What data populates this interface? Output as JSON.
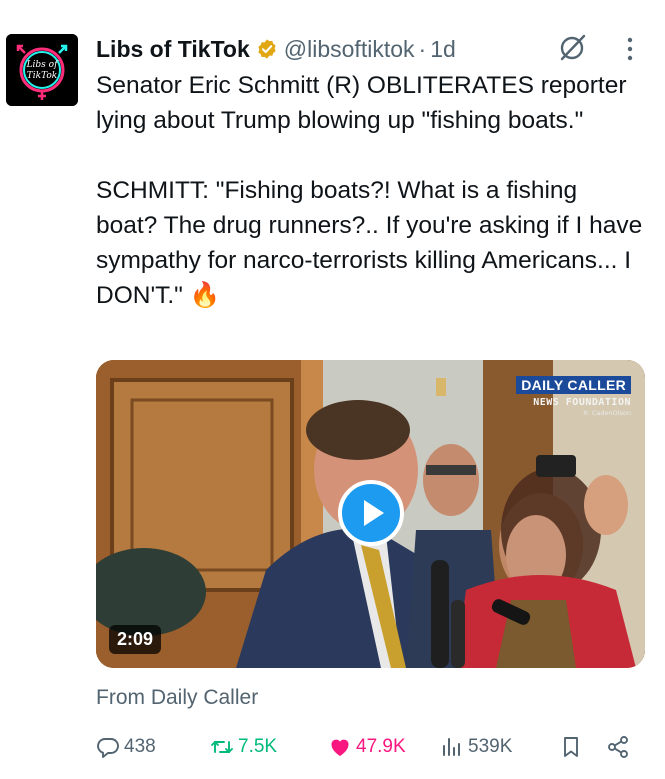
{
  "author": {
    "display_name": "Libs of TikTok",
    "handle": "@libsoftiktok",
    "separator": "·",
    "timestamp": "1d",
    "verified_badge": "verified-gold-icon",
    "avatar_text": "Libs of TikTok",
    "avatar_bg": "#000000"
  },
  "tweet": {
    "text": "Senator Eric Schmitt (R) OBLITERATES reporter lying about Trump blowing up \"fishing boats.\"\n\nSCHMITT: \"Fishing boats?! What is a fishing boat? The drug runners?.. If you're asking if I have sympathy for narco-terrorists killing Americans... I DON'T.\" 🔥"
  },
  "media": {
    "duration": "2:09",
    "watermark_brand": "DAILY CALLER",
    "watermark_sub": "NEWS FOUNDATION",
    "watermark_credit": "X: CadenOlson"
  },
  "source": "From Daily Caller",
  "actions": {
    "replies": "438",
    "reposts": "7.5K",
    "likes": "47.9K",
    "views": "539K"
  },
  "colors": {
    "accent": "#1d9bf0",
    "repost": "#00ba7c",
    "like": "#f91880",
    "muted": "#536471",
    "verified": "#e2a814"
  }
}
